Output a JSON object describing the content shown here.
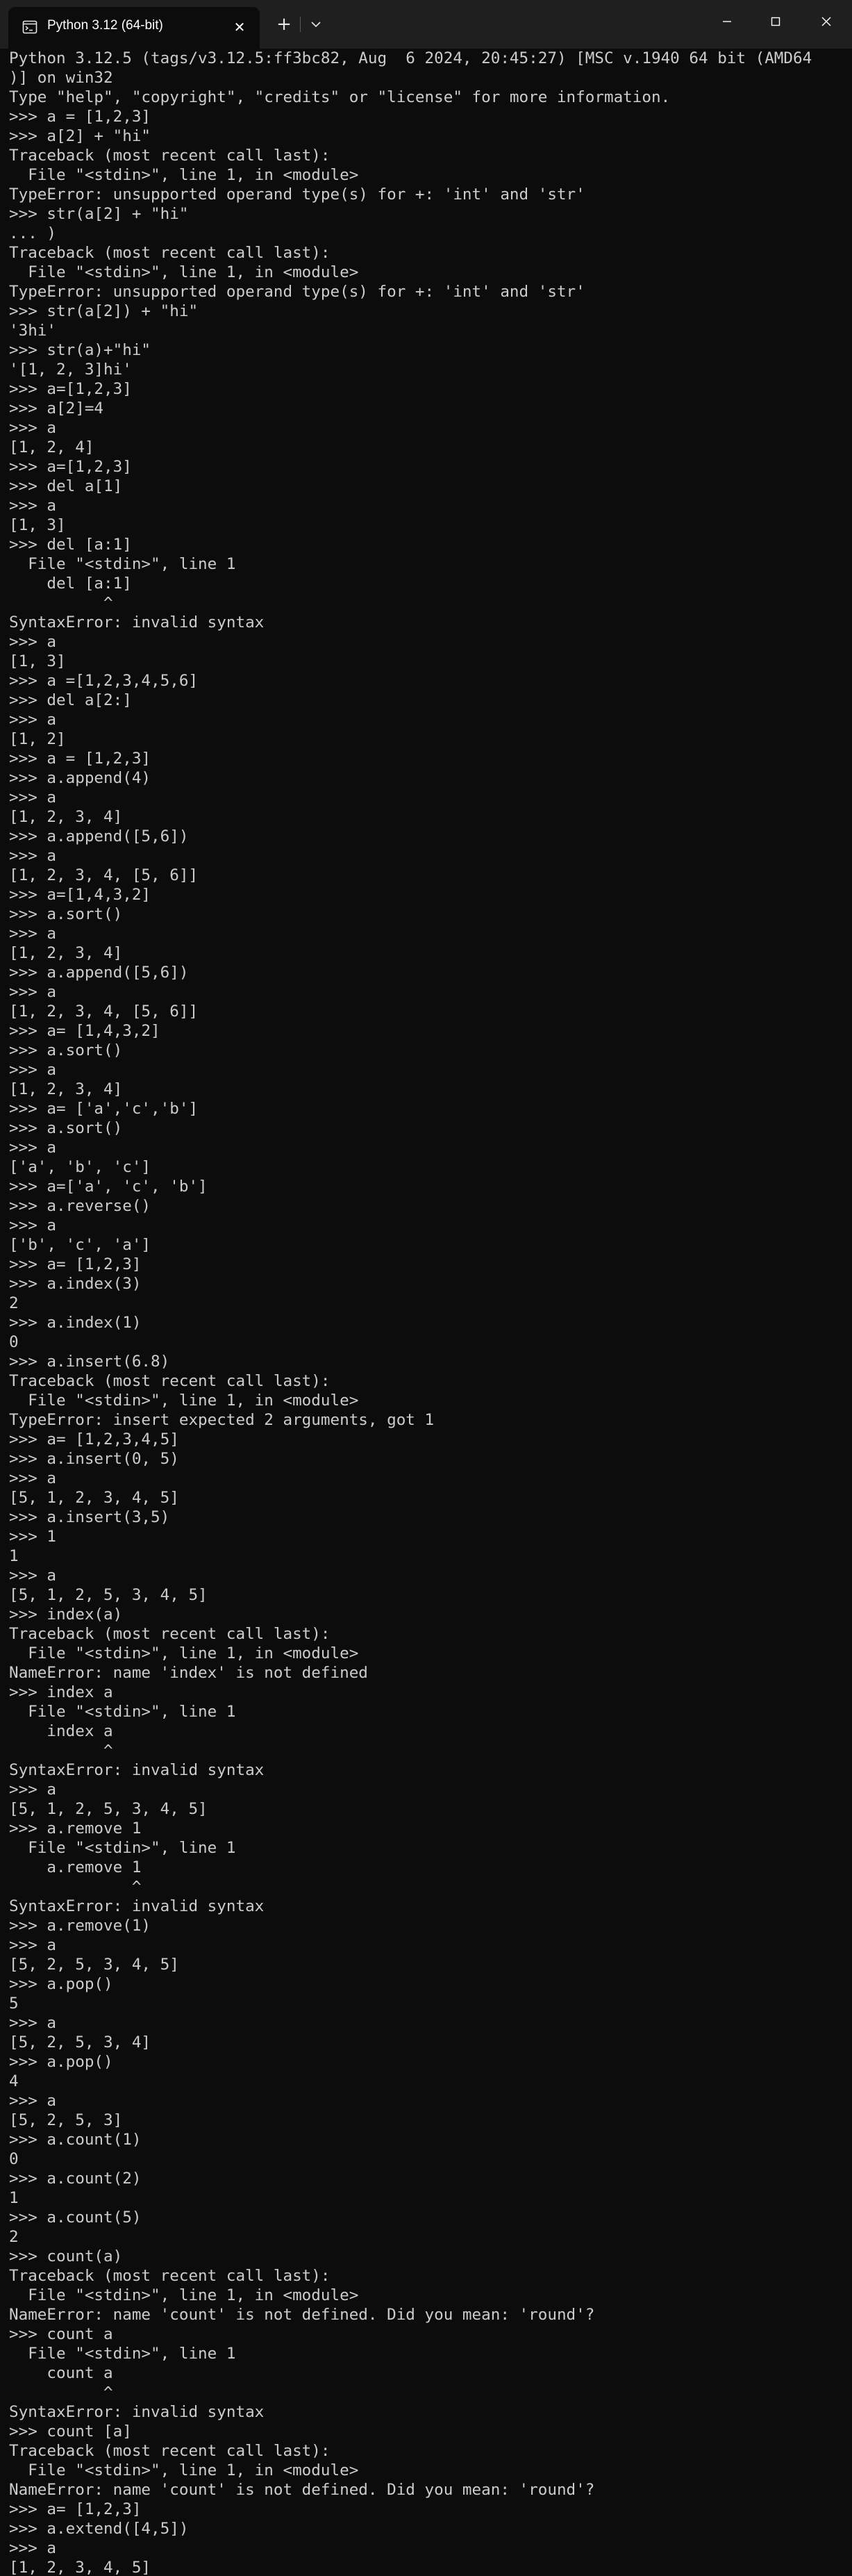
{
  "window": {
    "tab_title": "Python 3.12 (64-bit)",
    "close_tab_glyph": "✕",
    "new_tab_glyph": "+",
    "icons": [
      "terminal-icon",
      "close-icon",
      "plus-icon",
      "chevron-down-icon",
      "minimize-icon",
      "maximize-icon",
      "window-close-icon"
    ]
  },
  "colors": {
    "background": "#0c0c0c",
    "text": "#cccccc",
    "titlebar": "#1f1f1f"
  },
  "terminal": {
    "lines": [
      "Python 3.12.5 (tags/v3.12.5:ff3bc82, Aug  6 2024, 20:45:27) [MSC v.1940 64 bit (AMD64",
      ")] on win32",
      "Type \"help\", \"copyright\", \"credits\" or \"license\" for more information.",
      ">>> a = [1,2,3]",
      ">>> a[2] + \"hi\"",
      "Traceback (most recent call last):",
      "  File \"<stdin>\", line 1, in <module>",
      "TypeError: unsupported operand type(s) for +: 'int' and 'str'",
      ">>> str(a[2] + \"hi\"",
      "... )",
      "Traceback (most recent call last):",
      "  File \"<stdin>\", line 1, in <module>",
      "TypeError: unsupported operand type(s) for +: 'int' and 'str'",
      ">>> str(a[2]) + \"hi\"",
      "'3hi'",
      ">>> str(a)+\"hi\"",
      "'[1, 2, 3]hi'",
      ">>> a=[1,2,3]",
      ">>> a[2]=4",
      ">>> a",
      "[1, 2, 4]",
      ">>> a=[1,2,3]",
      ">>> del a[1]",
      ">>> a",
      "[1, 3]",
      ">>> del [a:1]",
      "  File \"<stdin>\", line 1",
      "    del [a:1]",
      "          ^",
      "SyntaxError: invalid syntax",
      ">>> a",
      "[1, 3]",
      ">>> a =[1,2,3,4,5,6]",
      ">>> del a[2:]",
      ">>> a",
      "[1, 2]",
      ">>> a = [1,2,3]",
      ">>> a.append(4)",
      ">>> a",
      "[1, 2, 3, 4]",
      ">>> a.append([5,6])",
      ">>> a",
      "[1, 2, 3, 4, [5, 6]]",
      ">>> a=[1,4,3,2]",
      ">>> a.sort()",
      ">>> a",
      "[1, 2, 3, 4]",
      ">>> a.append([5,6])",
      ">>> a",
      "[1, 2, 3, 4, [5, 6]]",
      ">>> a= [1,4,3,2]",
      ">>> a.sort()",
      ">>> a",
      "[1, 2, 3, 4]",
      ">>> a= ['a','c','b']",
      ">>> a.sort()",
      ">>> a",
      "['a', 'b', 'c']",
      ">>> a=['a', 'c', 'b']",
      ">>> a.reverse()",
      ">>> a",
      "['b', 'c', 'a']",
      ">>> a= [1,2,3]",
      ">>> a.index(3)",
      "2",
      ">>> a.index(1)",
      "0",
      ">>> a.insert(6.8)",
      "Traceback (most recent call last):",
      "  File \"<stdin>\", line 1, in <module>",
      "TypeError: insert expected 2 arguments, got 1",
      ">>> a= [1,2,3,4,5]",
      ">>> a.insert(0, 5)",
      ">>> a",
      "[5, 1, 2, 3, 4, 5]",
      ">>> a.insert(3,5)",
      ">>> 1",
      "1",
      ">>> a",
      "[5, 1, 2, 5, 3, 4, 5]",
      ">>> index(a)",
      "Traceback (most recent call last):",
      "  File \"<stdin>\", line 1, in <module>",
      "NameError: name 'index' is not defined",
      ">>> index a",
      "  File \"<stdin>\", line 1",
      "    index a",
      "          ^",
      "SyntaxError: invalid syntax",
      ">>> a",
      "[5, 1, 2, 5, 3, 4, 5]",
      ">>> a.remove 1",
      "  File \"<stdin>\", line 1",
      "    a.remove 1",
      "             ^",
      "SyntaxError: invalid syntax",
      ">>> a.remove(1)",
      ">>> a",
      "[5, 2, 5, 3, 4, 5]",
      ">>> a.pop()",
      "5",
      ">>> a",
      "[5, 2, 5, 3, 4]",
      ">>> a.pop()",
      "4",
      ">>> a",
      "[5, 2, 5, 3]",
      ">>> a.count(1)",
      "0",
      ">>> a.count(2)",
      "1",
      ">>> a.count(5)",
      "2",
      ">>> count(a)",
      "Traceback (most recent call last):",
      "  File \"<stdin>\", line 1, in <module>",
      "NameError: name 'count' is not defined. Did you mean: 'round'?",
      ">>> count a",
      "  File \"<stdin>\", line 1",
      "    count a",
      "          ^",
      "SyntaxError: invalid syntax",
      ">>> count [a]",
      "Traceback (most recent call last):",
      "  File \"<stdin>\", line 1, in <module>",
      "NameError: name 'count' is not defined. Did you mean: 'round'?",
      ">>> a= [1,2,3]",
      ">>> a.extend([4,5])",
      ">>> a",
      "[1, 2, 3, 4, 5]"
    ]
  }
}
